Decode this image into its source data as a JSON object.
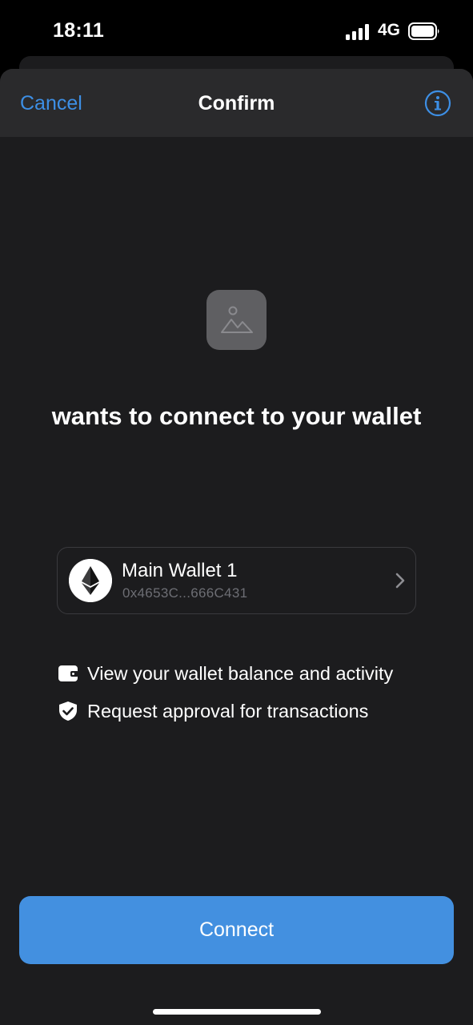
{
  "status_bar": {
    "time": "18:11",
    "network": "4G"
  },
  "nav": {
    "cancel_label": "Cancel",
    "title": "Confirm",
    "info_icon": "info-circle-icon"
  },
  "dapp": {
    "icon": "image-placeholder-icon",
    "headline": "wants to connect to your wallet"
  },
  "wallet": {
    "name": "Main Wallet 1",
    "address": "0x4653C...666C431",
    "icon": "ethereum-icon"
  },
  "permissions": [
    {
      "icon": "wallet-icon",
      "label": "View your wallet balance and activity"
    },
    {
      "icon": "shield-check-icon",
      "label": "Request approval for transactions"
    }
  ],
  "actions": {
    "connect_label": "Connect"
  },
  "colors": {
    "accent": "#4390e0",
    "link": "#3d8fe5",
    "sheet_background": "#1c1c1e",
    "nav_background": "#2a2a2c"
  }
}
